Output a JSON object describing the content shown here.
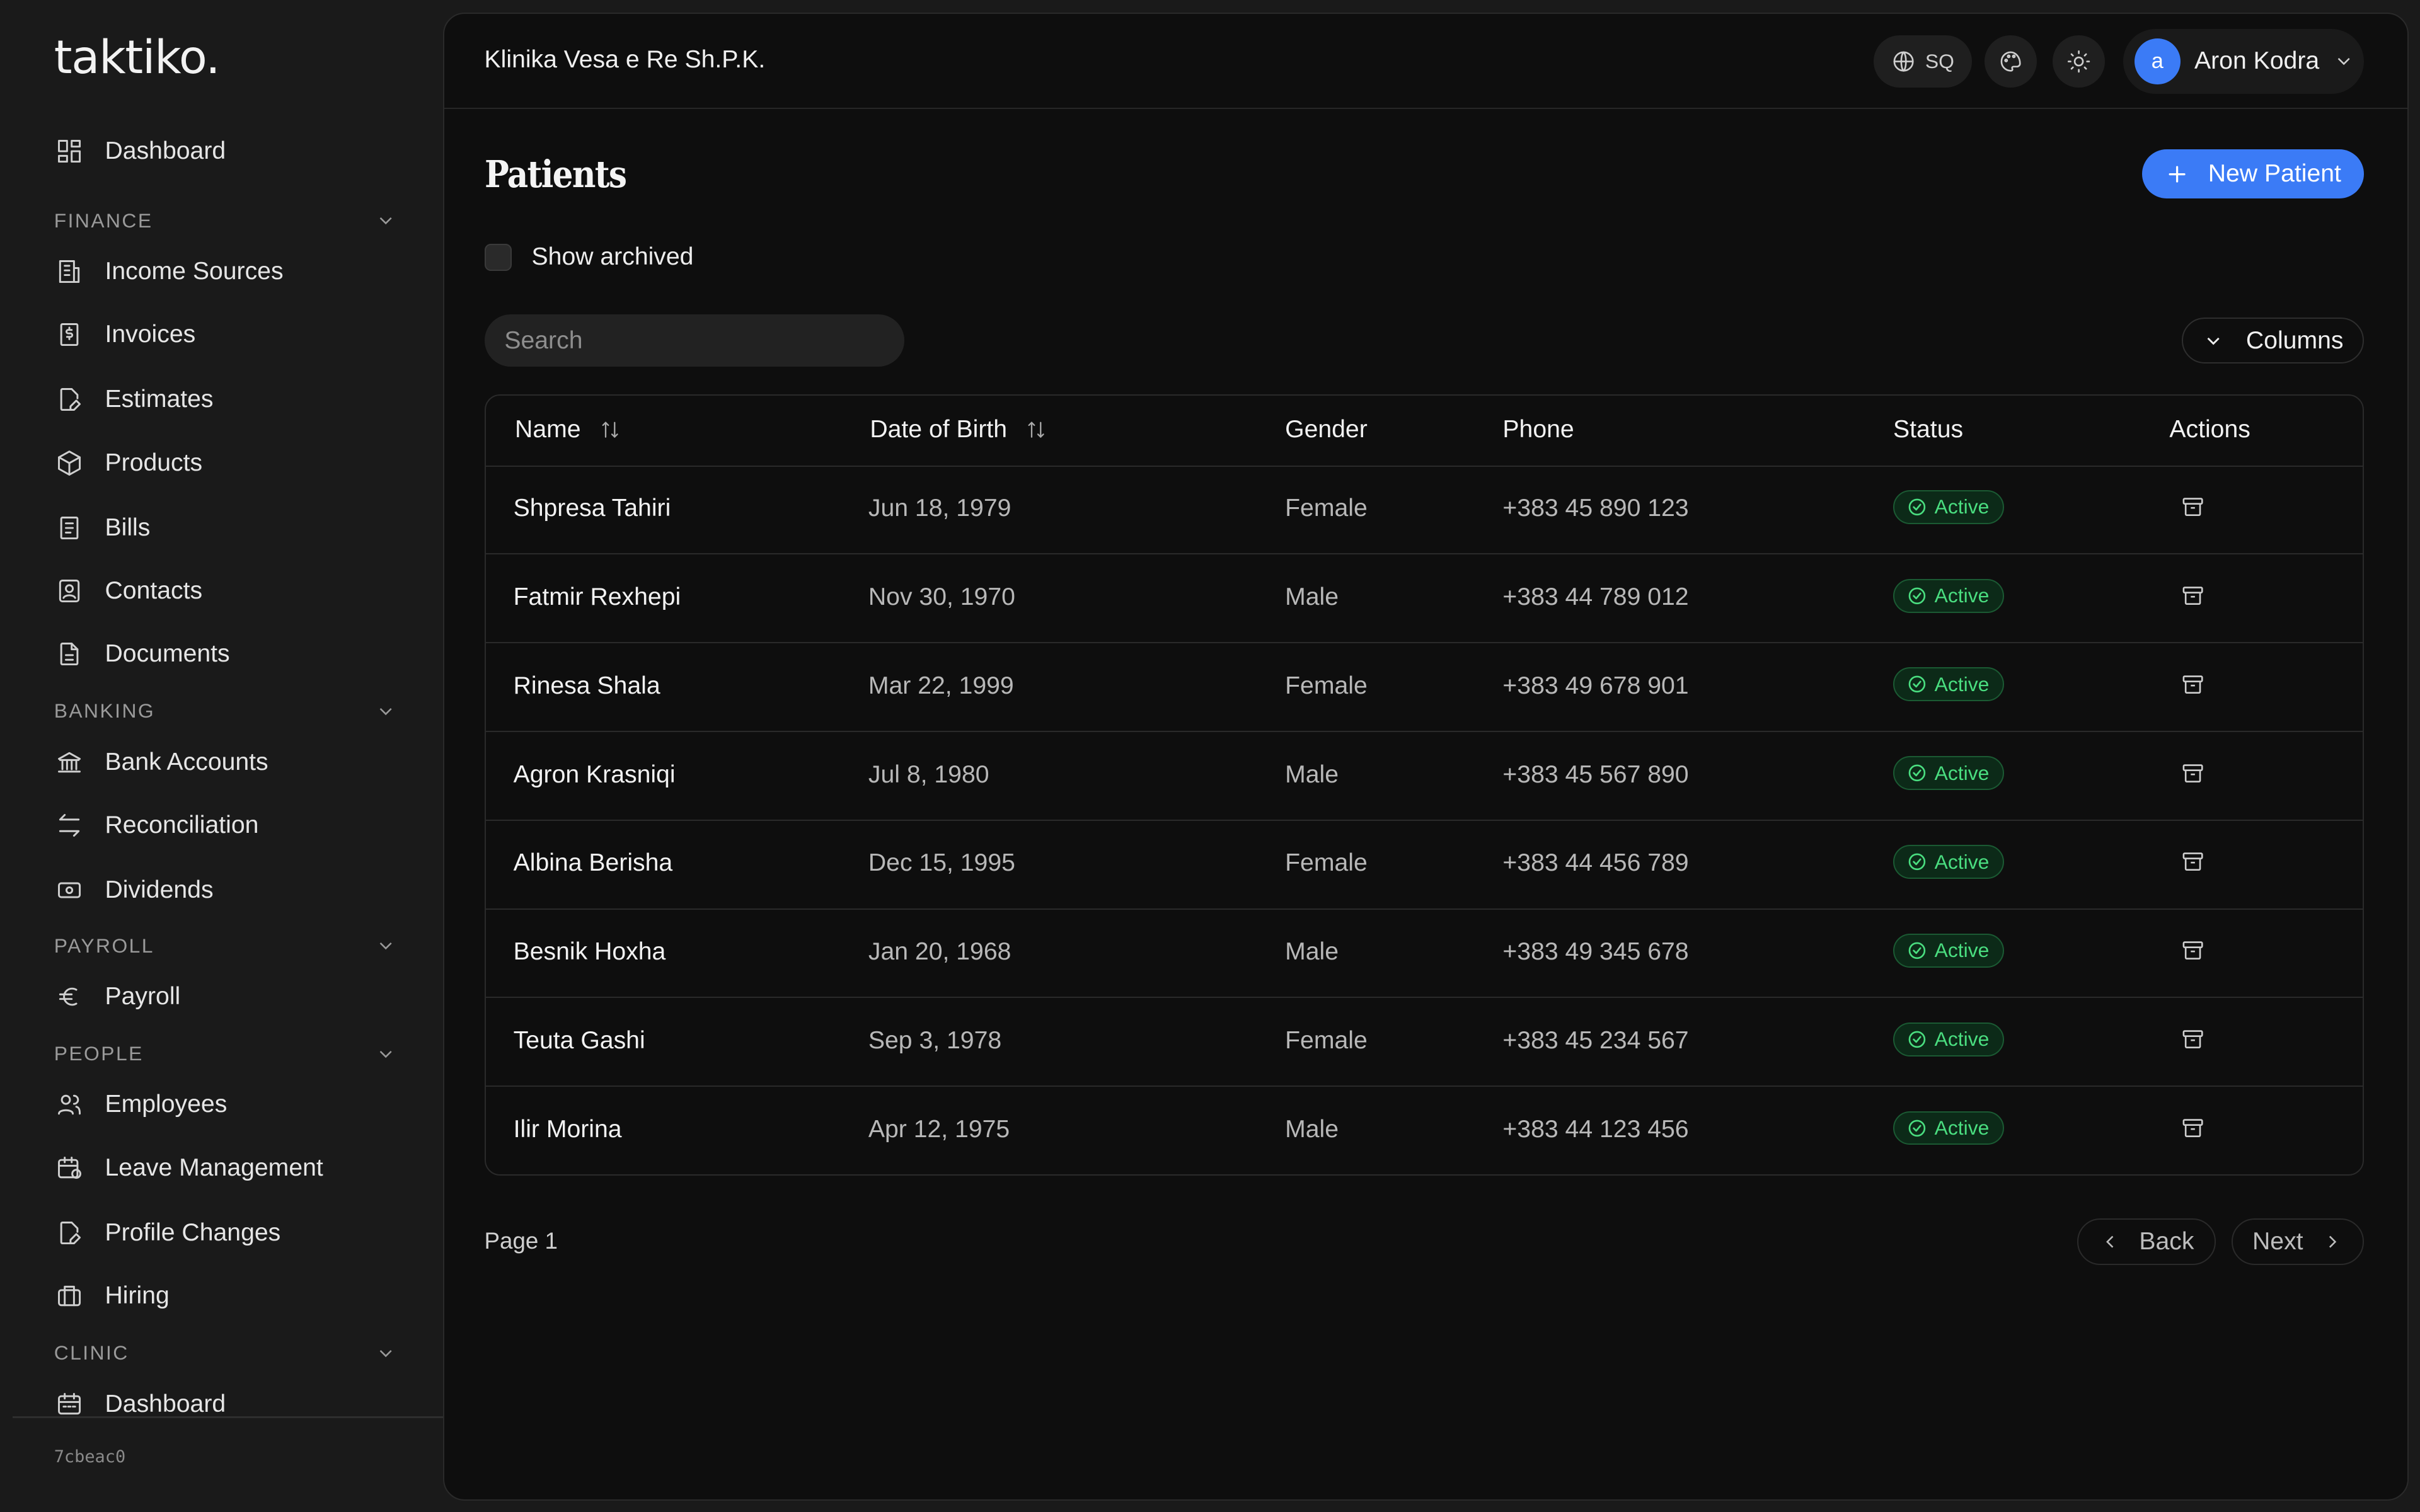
{
  "app": {
    "logo": "taktiko.",
    "version": "7cbeac0"
  },
  "sidebar": {
    "dashboard": "Dashboard",
    "sections": [
      {
        "title": "FINANCE",
        "items": [
          "Income Sources",
          "Invoices",
          "Estimates",
          "Products",
          "Bills",
          "Contacts",
          "Documents"
        ]
      },
      {
        "title": "BANKING",
        "items": [
          "Bank Accounts",
          "Reconciliation",
          "Dividends"
        ]
      },
      {
        "title": "PAYROLL",
        "items": [
          "Payroll"
        ]
      },
      {
        "title": "PEOPLE",
        "items": [
          "Employees",
          "Leave Management",
          "Profile Changes",
          "Hiring"
        ]
      },
      {
        "title": "CLINIC",
        "items": [
          "Dashboard"
        ]
      }
    ]
  },
  "header": {
    "organization": "Klinika Vesa e Re Sh.P.K.",
    "language": "SQ",
    "user": {
      "initial": "a",
      "name": "Aron Kodra"
    }
  },
  "page": {
    "title": "Patients",
    "new_button": "New Patient",
    "show_archived": "Show archived",
    "search_placeholder": "Search",
    "columns_button": "Columns"
  },
  "table": {
    "headers": {
      "name": "Name",
      "dob": "Date of Birth",
      "gender": "Gender",
      "phone": "Phone",
      "status": "Status",
      "actions": "Actions"
    },
    "rows": [
      {
        "name": "Shpresa Tahiri",
        "dob": "Jun 18, 1979",
        "gender": "Female",
        "phone": "+383 45 890 123",
        "status": "Active"
      },
      {
        "name": "Fatmir Rexhepi",
        "dob": "Nov 30, 1970",
        "gender": "Male",
        "phone": "+383 44 789 012",
        "status": "Active"
      },
      {
        "name": "Rinesa Shala",
        "dob": "Mar 22, 1999",
        "gender": "Female",
        "phone": "+383 49 678 901",
        "status": "Active"
      },
      {
        "name": "Agron Krasniqi",
        "dob": "Jul 8, 1980",
        "gender": "Male",
        "phone": "+383 45 567 890",
        "status": "Active"
      },
      {
        "name": "Albina Berisha",
        "dob": "Dec 15, 1995",
        "gender": "Female",
        "phone": "+383 44 456 789",
        "status": "Active"
      },
      {
        "name": "Besnik Hoxha",
        "dob": "Jan 20, 1968",
        "gender": "Male",
        "phone": "+383 49 345 678",
        "status": "Active"
      },
      {
        "name": "Teuta Gashi",
        "dob": "Sep 3, 1978",
        "gender": "Female",
        "phone": "+383 45 234 567",
        "status": "Active"
      },
      {
        "name": "Ilir Morina",
        "dob": "Apr 12, 1975",
        "gender": "Male",
        "phone": "+383 44 123 456",
        "status": "Active"
      }
    ]
  },
  "pagination": {
    "label": "Page 1",
    "back": "Back",
    "next": "Next"
  },
  "colors": {
    "accent": "#3b7bf6",
    "active_badge": "#4ade80"
  }
}
